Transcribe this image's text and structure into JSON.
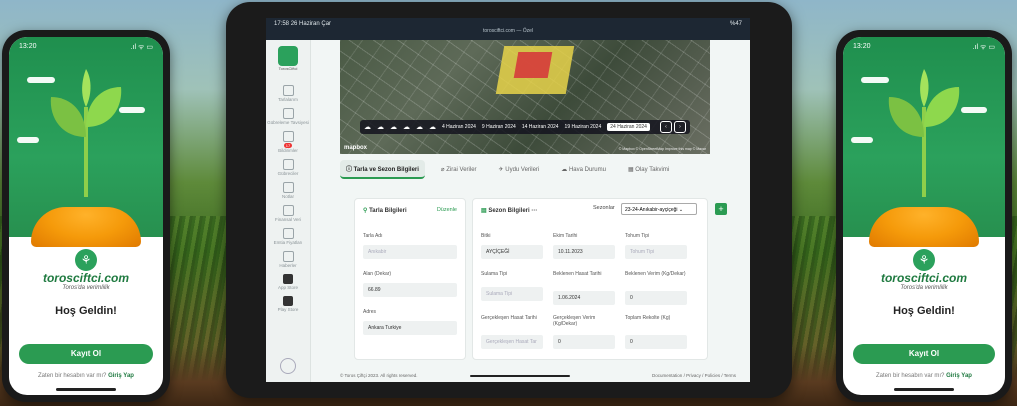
{
  "left_phone": {
    "time": "13:20",
    "status_icons": ".ıl ᯤ ▭",
    "brand": "torosciftci.com",
    "tagline": "Toros'da verimlilik",
    "welcome": "Hoş Geldin!",
    "register": "Kayıt Ol",
    "login_prompt": "Zaten bir hesabın var mı?",
    "login_link": "Giriş Yap"
  },
  "right_phone": {
    "time": "13:20",
    "status_icons": ".ıl ᯤ ▭",
    "brand": "torosciftci.com",
    "tagline": "Toros'da verimlilik",
    "welcome": "Hoş Geldin!",
    "register": "Kayıt Ol",
    "login_prompt": "Zaten bir hesabın var mı?",
    "login_link": "Giriş Yap"
  },
  "tablet": {
    "status_time": "17:58",
    "status_date": "26 Haziran Çar",
    "url": "torosciftci.com — Özel",
    "battery": "%47",
    "sidebar": {
      "brand": "TorosCiftci",
      "items": [
        {
          "label": "Tarlalarım",
          "icon": "grid-icon"
        },
        {
          "label": "Gübreleme Tavsiyesi",
          "icon": "fertilizer-icon"
        },
        {
          "label": "Bildirimler",
          "icon": "bell-icon",
          "badge": "17"
        },
        {
          "label": "Gübreciler",
          "icon": "store-icon"
        },
        {
          "label": "Notlar",
          "icon": "notes-icon"
        },
        {
          "label": "Finansal Veri",
          "icon": "finance-icon"
        },
        {
          "label": "Emtia Fiyatları",
          "icon": "chart-icon"
        },
        {
          "label": "Haberler",
          "icon": "news-icon"
        },
        {
          "label": "App Store",
          "icon": "apple-icon"
        },
        {
          "label": "Play Store",
          "icon": "play-icon"
        }
      ]
    },
    "timeline": {
      "dates": [
        "4 Haziran 2024",
        "9 Haziran 2024",
        "14 Haziran 2024",
        "19 Haziran 2024"
      ],
      "selected": "24 Haziran 2024"
    },
    "map_logo": "mapbox",
    "map_attrib": "© Mapbox © OpenStreetMap Improve this map © Maxar",
    "tabs": [
      "Tarla ve Sezon Bilgileri",
      "Zirai Veriler",
      "Uydu Verileri",
      "Hava Durumu",
      "Olay Takvimi"
    ],
    "field_panel": {
      "title": "Tarla Bilgileri",
      "edit": "Düzenle",
      "name_label": "Tarla Adı",
      "name_value": "Anıkabir",
      "area_label": "Alan (Dekar)",
      "area_value": "66.89",
      "address_label": "Adres",
      "address_value": "Ankara Turkiye"
    },
    "season_panel": {
      "title": "Sezon Bilgileri",
      "more": "···",
      "seasons_label": "Sezonlar",
      "season_value": "23-24-Anıkabir-ayçiçeği",
      "plus": "+",
      "fields": [
        {
          "label": "Bitki",
          "value": "AYÇİÇEĞİ",
          "placeholder": false
        },
        {
          "label": "Ekim Tarihi",
          "value": "10.11.2023",
          "placeholder": false
        },
        {
          "label": "Tohum Tipi",
          "value": "Tohum Tipi",
          "placeholder": true
        },
        {
          "label": "Sulama Tipi",
          "value": "Sulama Tipi",
          "placeholder": true
        },
        {
          "label": "Beklenen Hasat Tarihi",
          "value": "1.06.2024",
          "placeholder": false
        },
        {
          "label": "Beklenen Verim (Kg/Dekar)",
          "value": "0",
          "placeholder": false
        },
        {
          "label": "Gerçekleşen Hasat Tarihi",
          "value": "Gerçekleşen Hasat Tar",
          "placeholder": true
        },
        {
          "label": "Gerçekleşen Verim (Kg/Dekar)",
          "value": "0",
          "placeholder": false
        },
        {
          "label": "Toplam Rekolte (Kg)",
          "value": "0",
          "placeholder": false
        }
      ]
    },
    "footer_left": "© Toros Çiftçi 2023. All rights reserved.",
    "footer_right": "Documentation / Privacy / Policies / Terms"
  }
}
